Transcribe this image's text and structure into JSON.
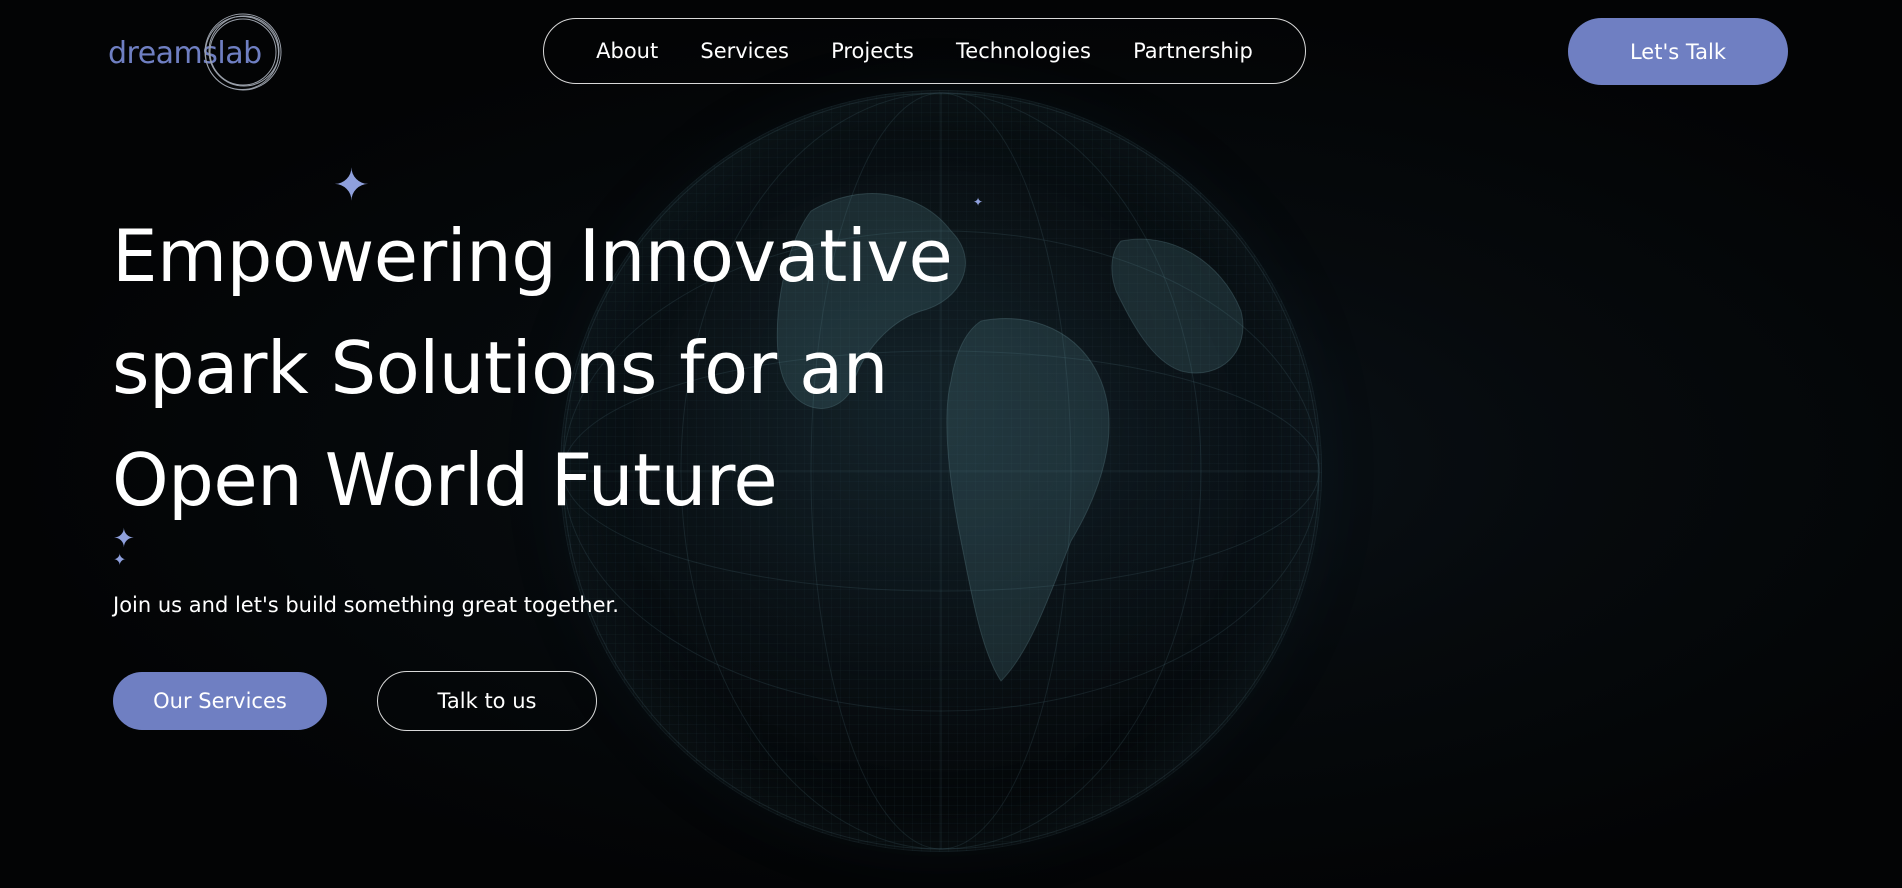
{
  "brand": {
    "logo_text": "dreamslab",
    "accent_color": "#6f7fc2"
  },
  "nav": {
    "items": [
      {
        "label": "About"
      },
      {
        "label": "Services"
      },
      {
        "label": "Projects"
      },
      {
        "label": "Technologies"
      },
      {
        "label": "Partnership"
      }
    ],
    "cta_label": "Let's Talk"
  },
  "hero": {
    "title_lines": [
      "Empowering Innovative",
      "spark Solutions for an",
      "Open World Future"
    ],
    "subtitle": "Join us and let's build something great together.",
    "primary_button": "Our Services",
    "secondary_button": "Talk to us"
  },
  "icons": {
    "sparkle": "sparkle-icon",
    "globe": "globe-background"
  }
}
